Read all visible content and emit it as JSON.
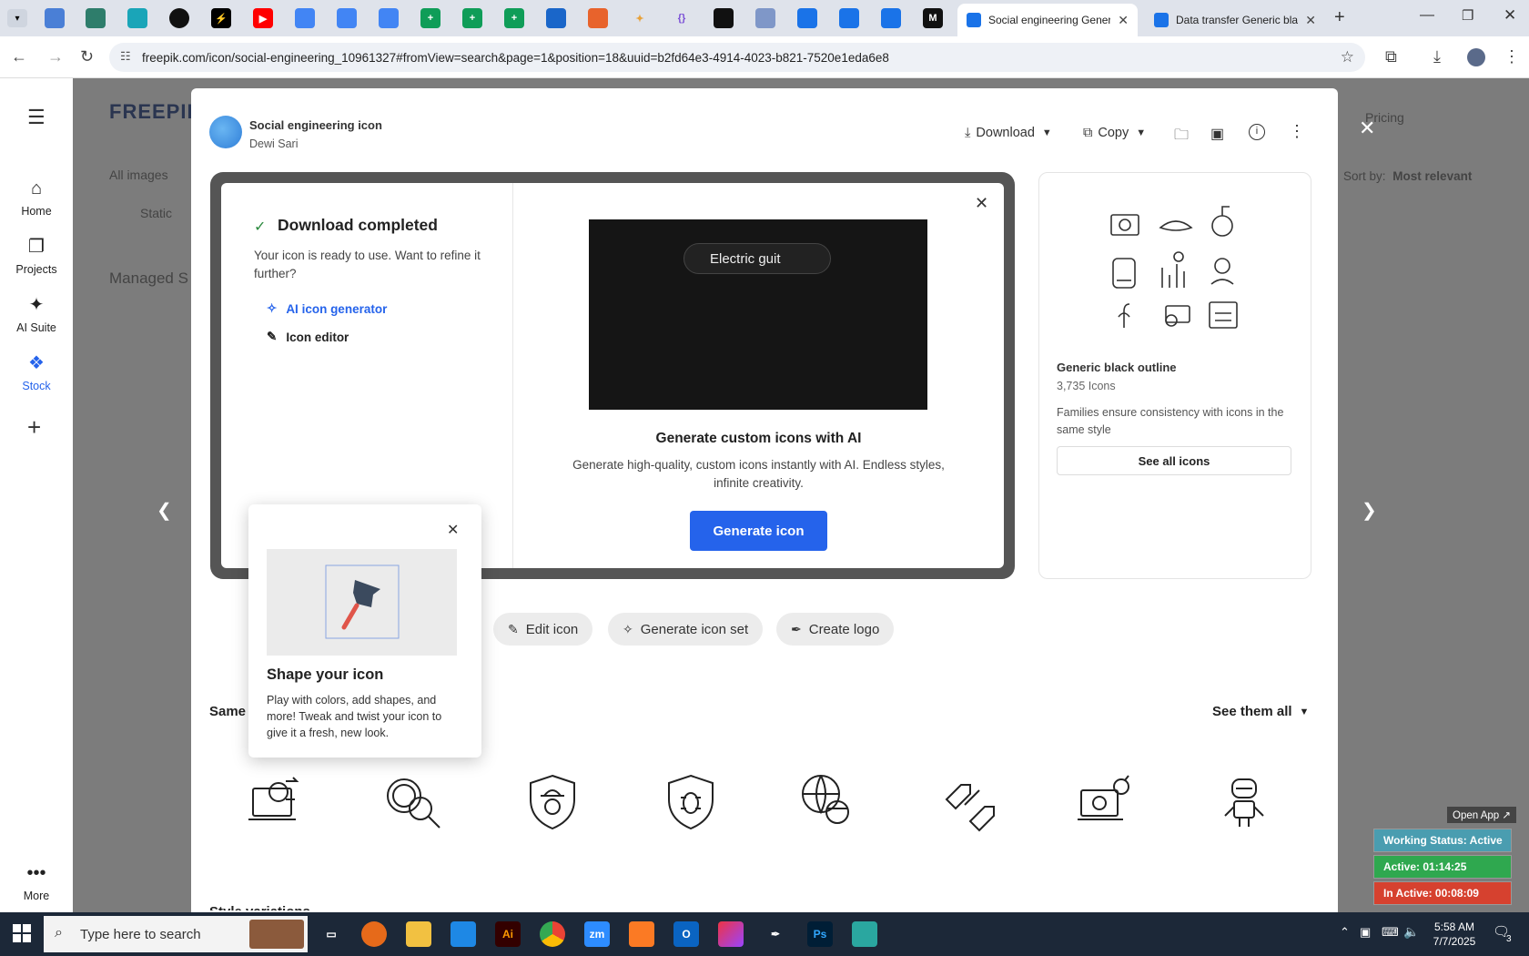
{
  "browser": {
    "tabs_pinned": [
      "",
      "",
      "",
      "",
      "",
      "",
      "",
      "",
      "",
      "",
      "",
      "",
      "",
      "",
      "",
      "",
      "",
      "",
      "",
      "",
      "",
      ""
    ],
    "active_tab": {
      "title": "Social engineering Gener",
      "close": "✕"
    },
    "other_tab": {
      "title": "Data transfer Generic bla",
      "close": "✕"
    },
    "new_tab": "+",
    "url": "freepik.com/icon/social-engineering_10961327#fromView=search&page=1&position=18&uuid=b2fd64e3-4914-4023-b821-7520e1eda6e8"
  },
  "leftnav": {
    "menu_icon": "☰",
    "items": [
      {
        "label": "Home",
        "icon": "home-icon"
      },
      {
        "label": "Projects",
        "icon": "projects-icon"
      },
      {
        "label": "AI Suite",
        "icon": "sparkle-icon"
      },
      {
        "label": "Stock",
        "icon": "stock-icon"
      }
    ],
    "add": "+",
    "more": "More"
  },
  "behind": {
    "logo": "FREEPIK",
    "all_images": "All images",
    "static": "Static",
    "managed": "Managed S",
    "sort_label": "Sort by:",
    "sort_value": "Most relevant",
    "pricing": "Pricing"
  },
  "modal": {
    "title": "Social engineering icon",
    "author": "Dewi Sari",
    "download_label": "Download",
    "copy_label": "Copy",
    "close": "✕"
  },
  "download_panel": {
    "heading": "Download completed",
    "desc": "Your icon is ready to use. Want to refine it further?",
    "ai_link": "AI icon generator",
    "editor_link": "Icon editor",
    "video_chip": "Electric guit",
    "gen_title": "Generate custom icons with AI",
    "gen_desc": "Generate high-quality, custom icons instantly with AI. Endless styles, infinite creativity.",
    "gen_button": "Generate icon",
    "close": "✕"
  },
  "family": {
    "name": "Generic black outline",
    "count": "3,735 Icons",
    "desc": "Families ensure consistency with icons in the same style",
    "see_all": "See all icons"
  },
  "actions": {
    "edit": "Edit icon",
    "set": "Generate icon set",
    "logo": "Create logo"
  },
  "tooltip": {
    "title": "Shape your icon",
    "text": "Play with colors, add shapes, and more! Tweak and twist your icon to give it a fresh, new look.",
    "close": "✕"
  },
  "same_section": {
    "label": "Same s",
    "see_all": "See them all"
  },
  "style_variations": "Style variations",
  "taskbar": {
    "search_placeholder": "Type here to search",
    "time": "5:58 AM",
    "date": "7/7/2025",
    "notifications": "3"
  },
  "tracker": {
    "open_app": "Open App ↗",
    "working": "Working Status: Active",
    "active": "Active: 01:14:25",
    "inactive": "In Active: 00:08:09",
    "colors": {
      "working": "#4a9db0",
      "active": "#2fa84f",
      "inactive": "#d6412f"
    }
  },
  "colors": {
    "accent": "#2563eb",
    "ai_link": "#2563eb",
    "check": "#2b8a3e"
  }
}
